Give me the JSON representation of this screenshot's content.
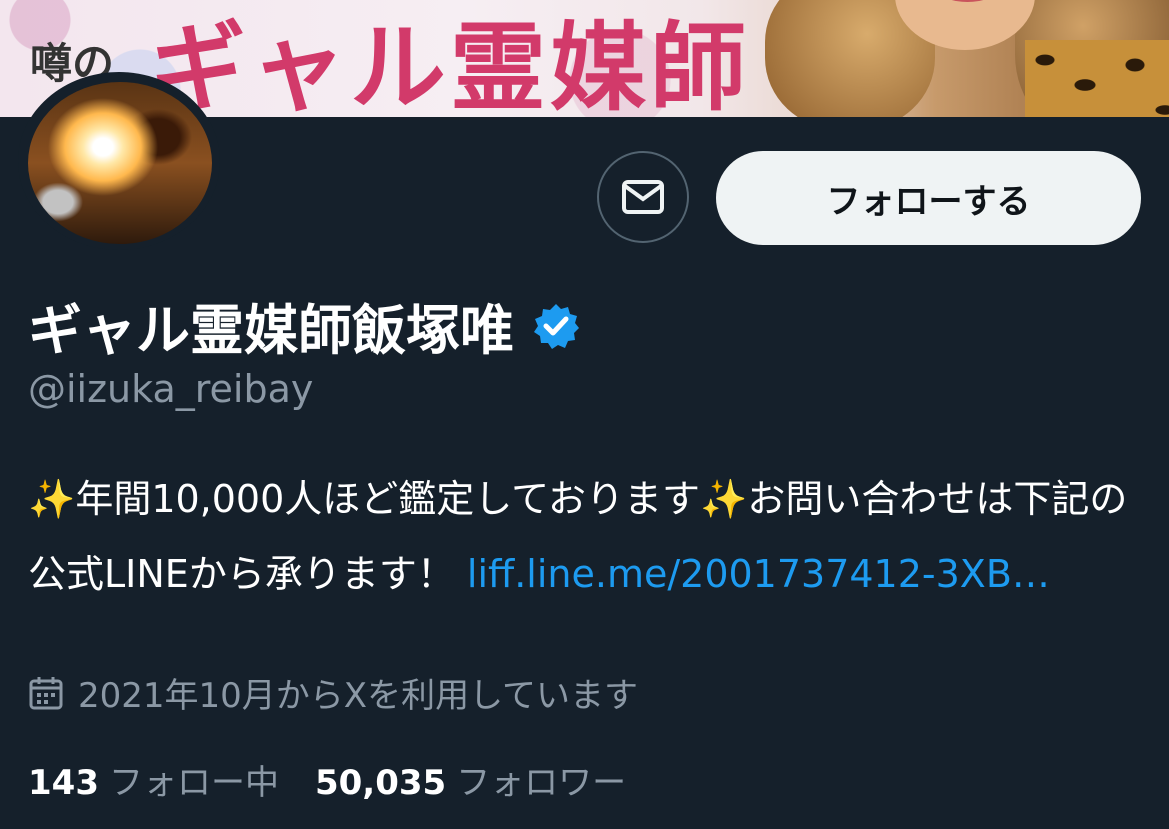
{
  "banner": {
    "title": "ギャル霊媒師",
    "small_text": "噂の"
  },
  "profile": {
    "display_name": "ギャル霊媒師飯塚唯",
    "handle": "@iizuka_reibay",
    "bio_text": "✨年間10,000人ほど鑑定しております✨お問い合わせは下記の公式LINEから承ります！ ",
    "bio_link": "liff.line.me/2001737412-3XB…",
    "joined": "2021年10月からXを利用しています",
    "following_count": "143",
    "following_label": "フォロー中",
    "followers_count": "50,035",
    "followers_label": "フォロワー"
  },
  "actions": {
    "follow_label": "フォローする",
    "message_icon": "mail-icon"
  },
  "colors": {
    "background": "#15202b",
    "link": "#1d9bf0",
    "verified": "#1d9bf0",
    "secondary_text": "#8b98a5"
  }
}
